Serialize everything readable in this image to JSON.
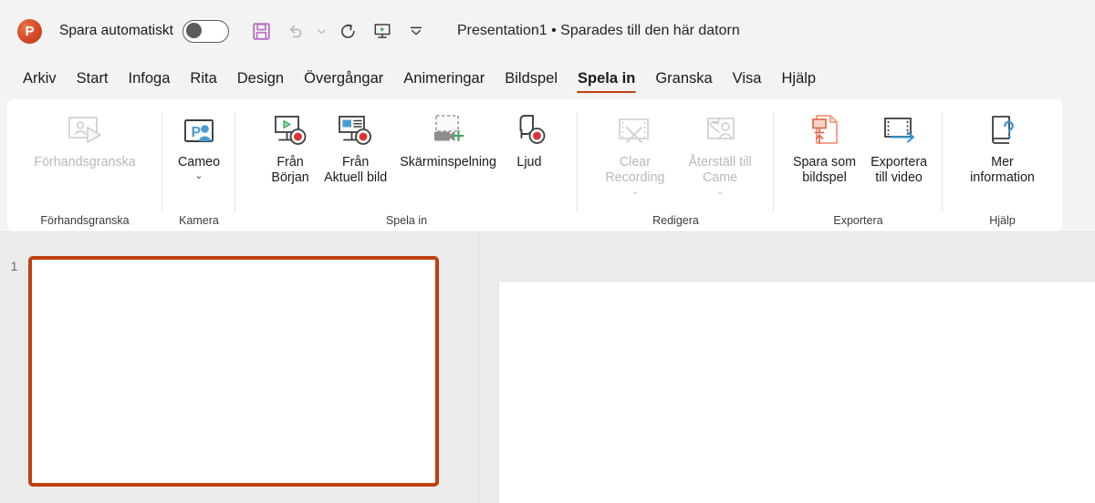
{
  "titlebar": {
    "logo_letter": "P",
    "autosave_label": "Spara automatiskt",
    "autosave_state": "off",
    "document_title": "Presentation1 • Sparades till den här datorn",
    "quick_access": [
      {
        "name": "save-icon",
        "label": "Spara"
      },
      {
        "name": "undo-icon",
        "label": "Ångra"
      },
      {
        "name": "undo-dropdown-icon",
        "label": "Ångra-meny"
      },
      {
        "name": "redo-icon",
        "label": "Gör om"
      },
      {
        "name": "slideshow-icon",
        "label": "Starta bildspel"
      },
      {
        "name": "more-options-icon",
        "label": "Fler alternativ"
      }
    ]
  },
  "tabs": [
    {
      "label": "Arkiv",
      "active": false
    },
    {
      "label": "Start",
      "active": false
    },
    {
      "label": "Infoga",
      "active": false
    },
    {
      "label": "Rita",
      "active": false
    },
    {
      "label": "Design",
      "active": false
    },
    {
      "label": "Övergångar",
      "active": false
    },
    {
      "label": "Animeringar",
      "active": false
    },
    {
      "label": "Bildspel",
      "active": false
    },
    {
      "label": "Spela in",
      "active": true
    },
    {
      "label": "Granska",
      "active": false
    },
    {
      "label": "Visa",
      "active": false
    },
    {
      "label": "Hjälp",
      "active": false
    }
  ],
  "ribbon": {
    "groups": [
      {
        "label": "Förhandsgranska",
        "items": [
          {
            "label": "Förhandsgranska",
            "icon": "preview-icon",
            "disabled": true,
            "caret": false
          }
        ]
      },
      {
        "label": "Kamera",
        "items": [
          {
            "label": "Cameo",
            "icon": "cameo-icon",
            "disabled": false,
            "caret": true
          }
        ]
      },
      {
        "label": "Spela in",
        "items": [
          {
            "label": "Från\nBörjan",
            "icon": "record-from-beginning-icon",
            "disabled": false,
            "caret": false
          },
          {
            "label": "Från\nAktuell bild",
            "icon": "record-from-current-slide-icon",
            "disabled": false,
            "caret": false
          },
          {
            "label": "Skärminspelning",
            "icon": "screen-recording-icon",
            "disabled": false,
            "caret": false
          },
          {
            "label": "Ljud",
            "icon": "audio-icon",
            "disabled": false,
            "caret": false
          }
        ]
      },
      {
        "label": "Redigera",
        "items": [
          {
            "label": "Clear\nRecording",
            "icon": "clear-recording-icon",
            "disabled": true,
            "caret": true
          },
          {
            "label": "Återställ till\nCame",
            "icon": "reset-to-cameo-icon",
            "disabled": true,
            "caret": true
          }
        ]
      },
      {
        "label": "Exportera",
        "items": [
          {
            "label": "Spara som\nbildspel",
            "icon": "save-as-show-icon",
            "disabled": false,
            "caret": false
          },
          {
            "label": "Exportera\ntill video",
            "icon": "export-to-video-icon",
            "disabled": false,
            "caret": false
          }
        ]
      },
      {
        "label": "Hjälp",
        "items": [
          {
            "label": "Mer\ninformation",
            "icon": "more-info-icon",
            "disabled": false,
            "caret": false
          }
        ]
      }
    ]
  },
  "workspace": {
    "slides": [
      {
        "number": "1",
        "selected": true
      }
    ]
  },
  "colors": {
    "accent": "#c0400f",
    "app_background": "#f3f3f3",
    "ribbon_background": "#ffffff",
    "workspace_background": "#ebebeb",
    "save_icon": "#b96fc4",
    "record_red": "#e03030",
    "play_green": "#3aa757",
    "cameo_blue": "#4a9ad4",
    "export_blue": "#2f94d3",
    "disabled_text": "#b9b9b9"
  }
}
